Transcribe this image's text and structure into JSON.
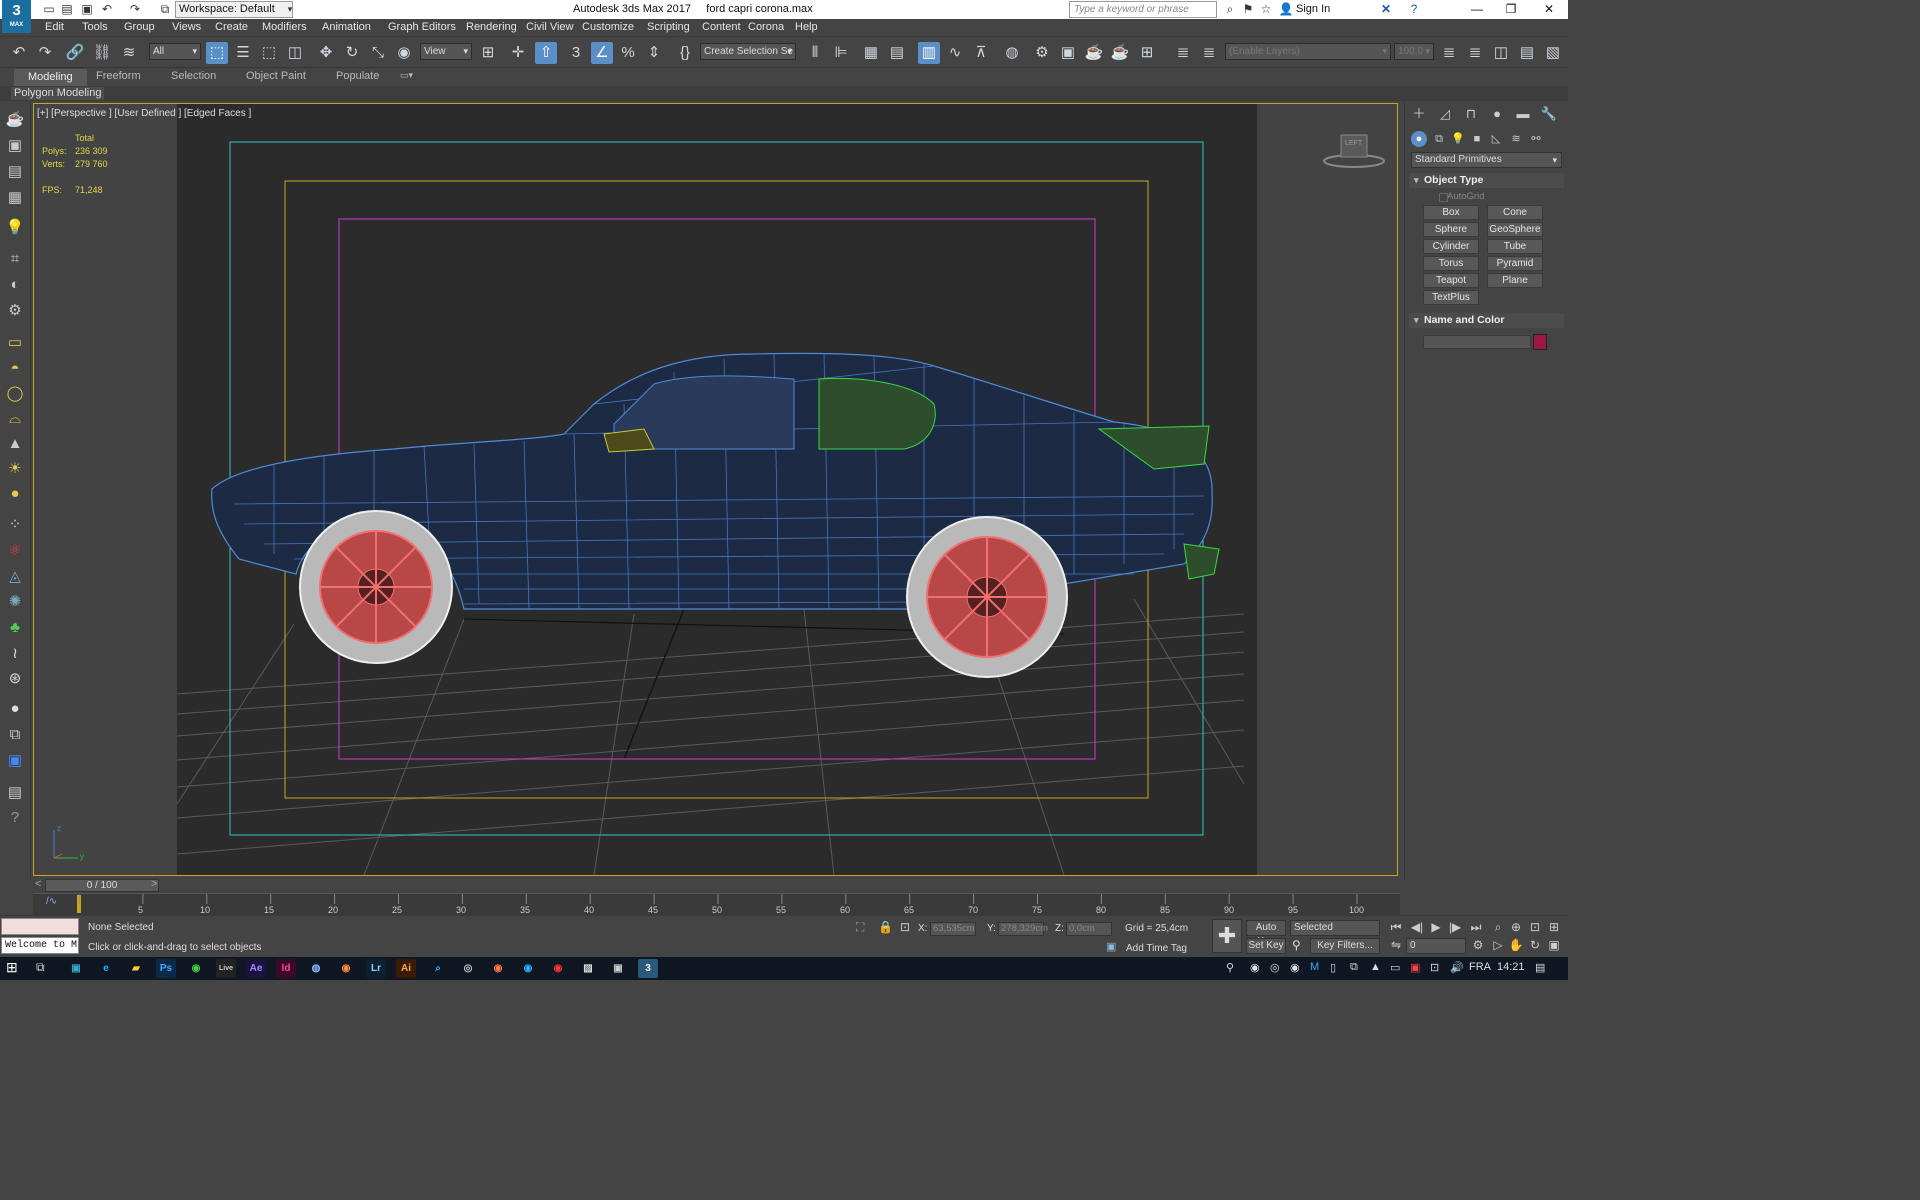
{
  "window": {
    "title": "Autodesk 3ds Max 2017     ford capri corona.max",
    "workspace": "Workspace: Default",
    "search_placeholder": "Type a keyword or phrase",
    "sign_in": "Sign In",
    "logo_text": "3",
    "logo_sub": "MAX"
  },
  "menu": [
    "Edit",
    "Tools",
    "Group",
    "Views",
    "Create",
    "Modifiers",
    "Animation",
    "Graph Editors",
    "Rendering",
    "Civil View",
    "Customize",
    "Scripting",
    "Content",
    "Corona",
    "Help"
  ],
  "toolbar": {
    "filter_select": "All",
    "ref_coord": "View",
    "selection_set": "Create Selection Se",
    "layers_placeholder": "(Enable Layers)",
    "layers_value": "100,0"
  },
  "ribbon": {
    "tabs": [
      "Modeling",
      "Freeform",
      "Selection",
      "Object Paint",
      "Populate"
    ],
    "active_tab": "Modeling",
    "panel": "Polygon Modeling"
  },
  "viewport": {
    "label": "[+] [Perspective ] [User Defined ] [Edged Faces ]",
    "stats": {
      "header": "Total",
      "polys_label": "Polys:",
      "polys": "236 309",
      "verts_label": "Verts:",
      "verts": "279 760",
      "fps_label": "FPS:",
      "fps": "71,248"
    },
    "cube_label": "LEFT",
    "axis_z": "z",
    "axis_y": "y"
  },
  "command_panel": {
    "primitive_type": "Standard Primitives",
    "object_type_header": "Object Type",
    "autogrid": "AutoGrid",
    "buttons": [
      "Box",
      "Cone",
      "Sphere",
      "GeoSphere",
      "Cylinder",
      "Tube",
      "Torus",
      "Pyramid",
      "Teapot",
      "Plane",
      "TextPlus"
    ],
    "name_color_header": "Name and Color",
    "object_color": "#9b1842"
  },
  "timeline": {
    "frame": "0 / 100",
    "ticks": [
      "5",
      "10",
      "15",
      "20",
      "25",
      "30",
      "35",
      "40",
      "45",
      "50",
      "55",
      "60",
      "65",
      "70",
      "75",
      "80",
      "85",
      "90",
      "95",
      "100"
    ]
  },
  "status": {
    "selection": "None Selected",
    "prompt": "Click or click-and-drag to select objects",
    "welcome": "Welcome to M",
    "x_label": "X:",
    "x": "63,535cm",
    "y_label": "Y:",
    "y": "278,329cm",
    "z_label": "Z:",
    "z": "0,0cm",
    "grid": "Grid = 25,4cm",
    "add_time_tag": "Add Time Tag",
    "auto_key": "Auto Key",
    "set_key": "Set Key",
    "key_mode": "Selected",
    "key_filters": "Key Filters...",
    "frame_field": "0"
  },
  "taskbar": {
    "lang": "FRA",
    "time": "14:21",
    "apps": [
      "Ps",
      "Live",
      "Ae",
      "Id",
      "Lr",
      "Ai"
    ]
  }
}
